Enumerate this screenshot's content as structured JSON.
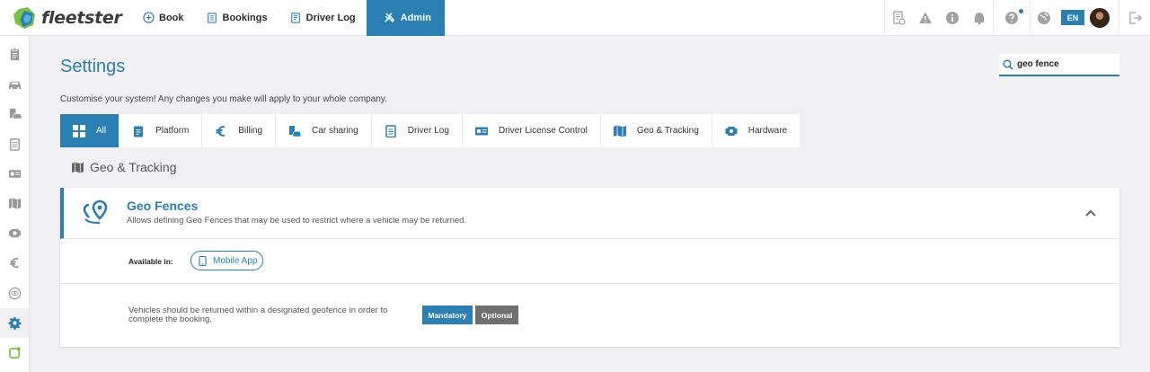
{
  "app": {
    "logo_text": "fleetster"
  },
  "nav": [
    {
      "label": "Book",
      "icon": "plus-circle-icon"
    },
    {
      "label": "Bookings",
      "icon": "clipboard-icon"
    },
    {
      "label": "Driver Log",
      "icon": "log-icon"
    },
    {
      "label": "Admin",
      "icon": "tools-icon",
      "active": true
    }
  ],
  "header_right": {
    "language": "EN"
  },
  "sidebar": [
    "clipboard",
    "cars",
    "car-sharing",
    "log",
    "license",
    "map",
    "hardware",
    "euro",
    "eye",
    "settings",
    "app"
  ],
  "page": {
    "title": "Settings",
    "subtitle": "Customise your system! Any changes you make will apply to your whole company."
  },
  "search": {
    "value": "geo fence",
    "placeholder": "Search"
  },
  "tabs": [
    {
      "label": "All",
      "active": true
    },
    {
      "label": "Platform"
    },
    {
      "label": "Billing"
    },
    {
      "label": "Car sharing"
    },
    {
      "label": "Driver Log"
    },
    {
      "label": "Driver License Control"
    },
    {
      "label": "Geo & Tracking"
    },
    {
      "label": "Hardware"
    }
  ],
  "section": {
    "title": "Geo & Tracking"
  },
  "card": {
    "title": "Geo Fences",
    "description": "Allows defining Geo Fences that may be used to restrict where a vehicle may be returned.",
    "available_label": "Available in:",
    "available_pill": "Mobile App",
    "rule_text": "Vehicles should be returned within a designated geofence in order to complete the booking.",
    "options": [
      "Mandatory",
      "Optional"
    ],
    "selected_option": "Mandatory"
  },
  "colors": {
    "accent": "#2a7fb3",
    "green": "#7cc242",
    "optional": "#6f6f6f"
  }
}
